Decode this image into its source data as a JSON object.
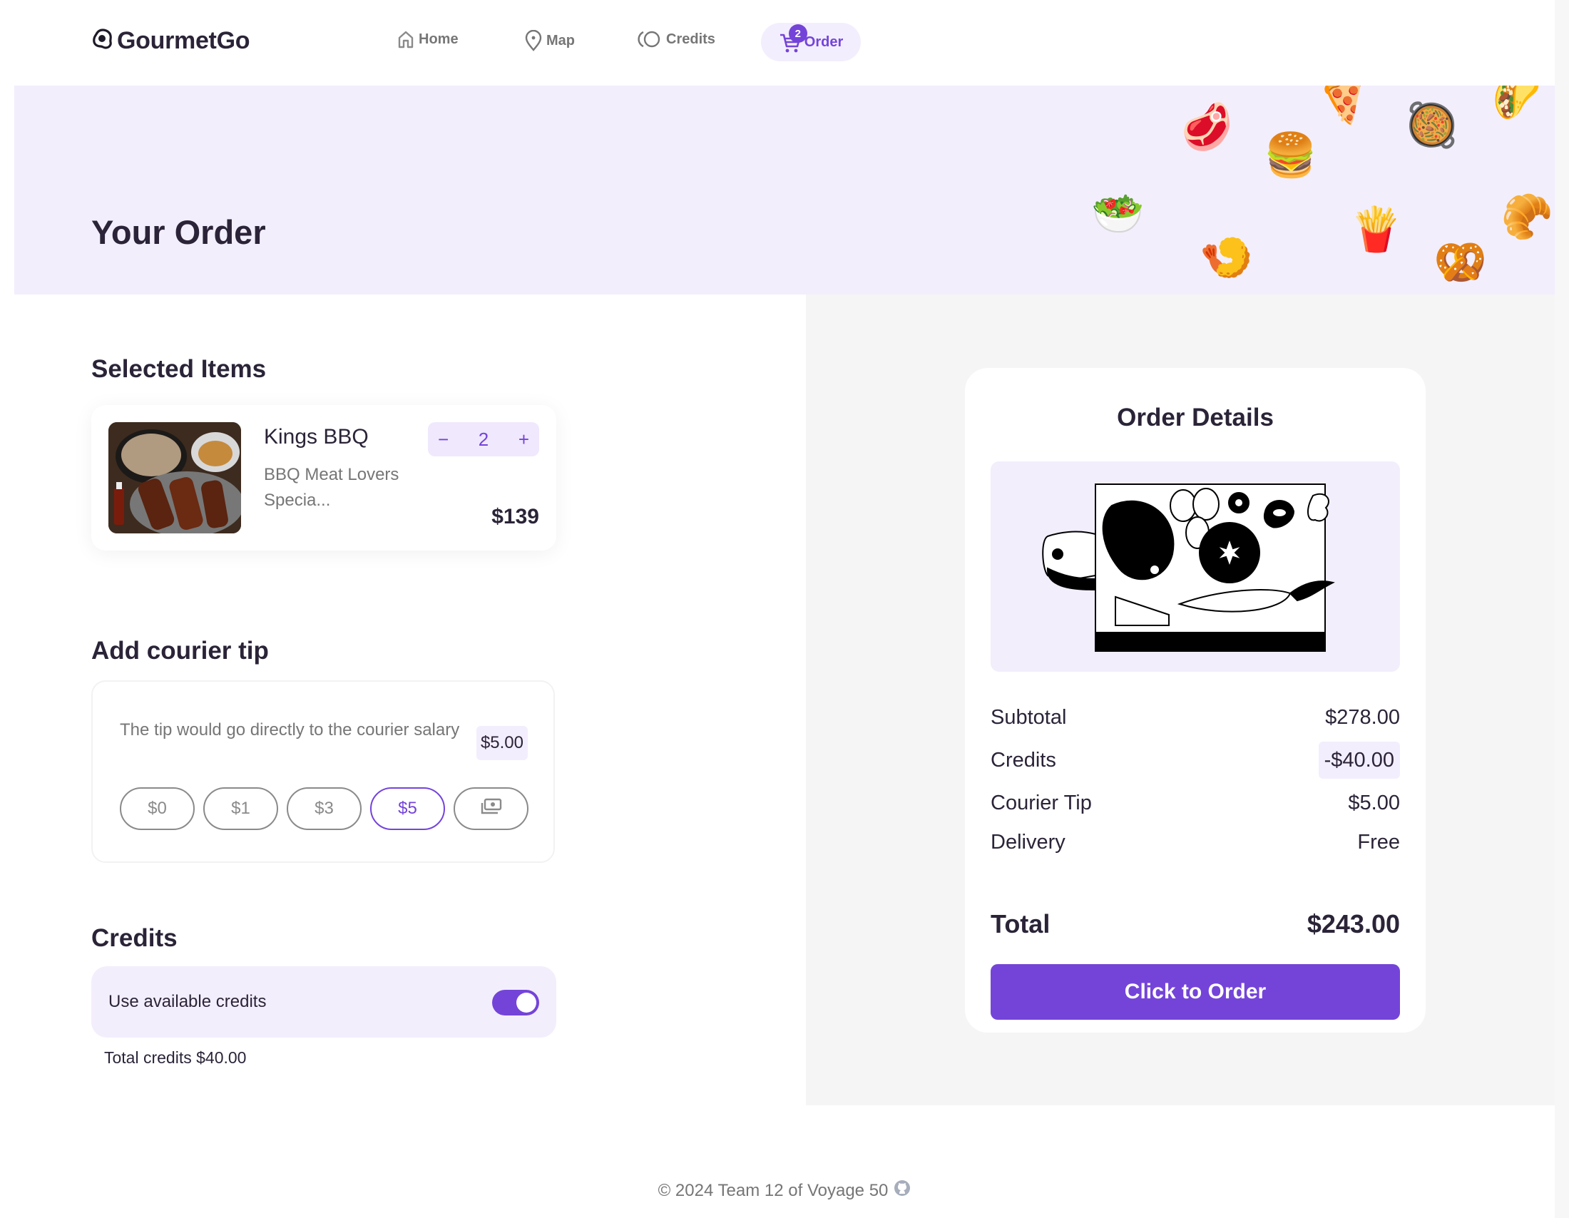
{
  "app": {
    "name": "GourmetGo"
  },
  "nav": {
    "items": [
      {
        "label": "Home",
        "icon": "home-icon"
      },
      {
        "label": "Map",
        "icon": "map-pin-icon"
      },
      {
        "label": "Credits",
        "icon": "coins-icon"
      },
      {
        "label": "Order",
        "icon": "cart-icon",
        "active": true,
        "badge": "2"
      }
    ]
  },
  "hero": {
    "title": "Your Order",
    "foods": [
      "🥩",
      "🍕",
      "🥘",
      "🌮",
      "🍔",
      "🥗",
      "🍤",
      "🍟",
      "🥨",
      "🥐"
    ]
  },
  "selected_items": {
    "title": "Selected Items",
    "items": [
      {
        "name": "Kings BBQ",
        "description": "BBQ Meat Lovers Specia...",
        "quantity": "2",
        "price": "$139",
        "decrement": "−",
        "increment": "+"
      }
    ]
  },
  "tip": {
    "title": "Add courier tip",
    "description": "The tip would go directly to the courier salary",
    "current_value": "$5.00",
    "options": [
      "$0",
      "$1",
      "$3",
      "$5"
    ],
    "selected": "$5",
    "custom_icon": "cash-icon"
  },
  "credits": {
    "title": "Credits",
    "toggle_label": "Use available credits",
    "toggle_on": true,
    "total_label": "Total credits $40.00"
  },
  "order_details": {
    "title": "Order Details",
    "rows": [
      {
        "label": "Subtotal",
        "value": "$278.00"
      },
      {
        "label": "Credits",
        "value": "-$40.00"
      },
      {
        "label": "Courier Tip",
        "value": "$5.00"
      },
      {
        "label": "Delivery",
        "value": "Free"
      }
    ],
    "total_label": "Total",
    "total_value": "$243.00",
    "button_label": "Click to Order"
  },
  "footer": {
    "text": "© 2024 Team 12 of Voyage 50"
  },
  "colors": {
    "accent": "#7444d9",
    "accent_light": "#f3eefd",
    "text": "#2b2438",
    "muted": "#767676"
  }
}
